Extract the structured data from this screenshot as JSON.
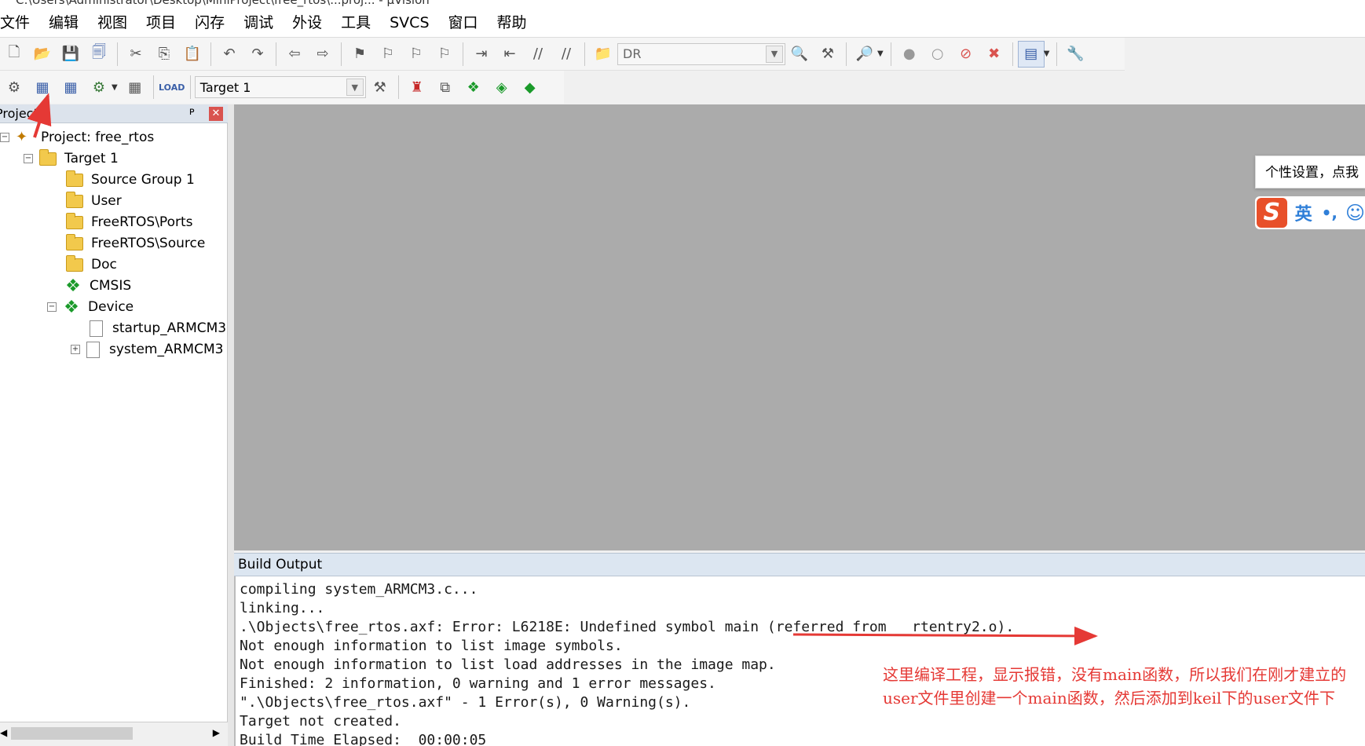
{
  "window_title": "C:\\Users\\Administrator\\Desktop\\MiniProject\\free_rtos\\...proj... - µVision",
  "menu": [
    "文件",
    "编辑",
    "视图",
    "项目",
    "闪存",
    "调试",
    "外设",
    "工具",
    "SVCS",
    "窗口",
    "帮助"
  ],
  "toolbar": {
    "find_combo_value": "DR",
    "target_combo_value": "Target 1"
  },
  "project_panel": {
    "title": "Project",
    "pin_glyph": "ᴘ",
    "close_glyph": "✕",
    "tree": {
      "root": "Project: free_rtos",
      "target": "Target 1",
      "groups": [
        "Source Group 1",
        "User",
        "FreeRTOS\\Ports",
        "FreeRTOS\\Source",
        "Doc"
      ],
      "cmsis": "CMSIS",
      "device": "Device",
      "device_files": [
        "startup_ARMCM3",
        "system_ARMCM3"
      ]
    }
  },
  "ime": {
    "tip": "个性设置，点我",
    "logo": "S",
    "lang": "英",
    "punct": "•,",
    "face": "☺"
  },
  "build_output": {
    "title": "Build Output",
    "lines": [
      "compiling system_ARMCM3.c...",
      "linking...",
      ".\\Objects\\free_rtos.axf: Error: L6218E: Undefined symbol main (referred from __rtentry2.o).",
      "Not enough information to list image symbols.",
      "Not enough information to list load addresses in the image map.",
      "Finished: 2 information, 0 warning and 1 error messages.",
      "\".\\Objects\\free_rtos.axf\" - 1 Error(s), 0 Warning(s).",
      "Target not created.",
      "Build Time Elapsed:  00:00:05"
    ]
  },
  "annotation": {
    "text": "这里编译工程，显示报错，没有main函数，所以我们在刚才建立的user文件里创建一个main函数，然后添加到keil下的user文件下",
    "color": "#e53935"
  },
  "colors": {
    "editor_bg": "#ababab",
    "panel_header": "#dce3ec",
    "annotation_red": "#e53935"
  }
}
